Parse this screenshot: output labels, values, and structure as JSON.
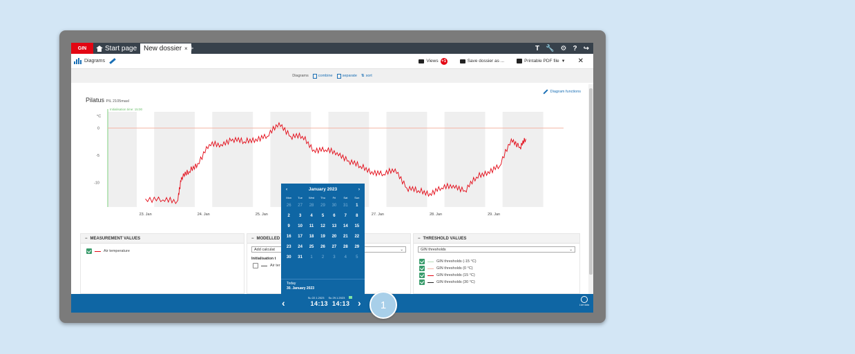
{
  "tabs": {
    "brand": "GIN",
    "home_label": "Start page",
    "active_label": "New dossier",
    "close_glyph": "×",
    "add_glyph": "+",
    "right_icons": [
      "T",
      "🔧",
      "⚙",
      "?",
      "↪"
    ]
  },
  "toolbar": {
    "title": "Diagrams",
    "views_label": "Views",
    "views_count": "+1",
    "save_label": "Save dossier as ...",
    "print_label": "Printable PDF file",
    "close_glyph": "✕"
  },
  "subbar": {
    "label": "Diagrams",
    "combine": "combine",
    "separate": "separate",
    "sort": "sort"
  },
  "chart": {
    "functions_label": "Diagram functions",
    "title": "Pilatus",
    "subtitle": "PIL 2105masl",
    "init_label": "Initialisation time: 15:00",
    "ylabel": "°C"
  },
  "chart_data": {
    "type": "line",
    "title": "Pilatus",
    "ylabel": "°C",
    "x_ticks": [
      "23. Jan",
      "24. Jan",
      "25. Jan",
      "26. Jan",
      "27. Jan",
      "28. Jan",
      "29. Jan"
    ],
    "y_ticks": [
      0,
      -5,
      -10
    ],
    "ylim": [
      -14.5,
      3
    ],
    "threshold_line": 0,
    "series": [
      {
        "name": "Air temperature",
        "color": "#e30613",
        "x": [
          0,
          0.3,
          0.55,
          0.62,
          0.75,
          0.9,
          1.1,
          1.3,
          1.5,
          1.7,
          1.9,
          2.1,
          2.3,
          2.5,
          2.7,
          2.9,
          3.1,
          3.3,
          3.5,
          3.7,
          3.9,
          4.1,
          4.3,
          4.5,
          4.7,
          4.9,
          5.1,
          5.3,
          5.5,
          5.7,
          5.9,
          6.1,
          6.3,
          6.45,
          6.55
        ],
        "values": [
          -13,
          -13.2,
          -13.4,
          -9,
          -8,
          -6.5,
          -3,
          -3,
          -2,
          -2.5,
          -2,
          -1.5,
          1,
          -1.5,
          -1.5,
          -4,
          -4,
          -4.5,
          -6,
          -7,
          -8,
          -8.5,
          -7.5,
          -11,
          -11.5,
          -12,
          -11,
          -10.5,
          -11.5,
          -9,
          -8,
          -7,
          -2,
          -3.5,
          -2
        ]
      }
    ]
  },
  "panels": {
    "measurement": {
      "title": "MEASUREMENT VALUES",
      "items": [
        {
          "label": "Air temperature",
          "checked": true,
          "color": "#e30613"
        }
      ]
    },
    "modelled": {
      "title": "MODELLED",
      "select_value": "Add calculat",
      "sub_title": "Initialisation t",
      "items": [
        {
          "label": "Air ter",
          "checked": false,
          "color": "#555555"
        }
      ]
    },
    "threshold": {
      "title": "THRESHOLD VALUES",
      "select_value": "GIN thresholds",
      "items": [
        {
          "label": "GIN thresholds (-15 °C)",
          "checked": true,
          "color": "#b7dcb7"
        },
        {
          "label": "GIN thresholds (0 °C)",
          "checked": true,
          "color": "#f3b4a4"
        },
        {
          "label": "GIN thresholds (15 °C)",
          "checked": true,
          "color": "#e30613"
        },
        {
          "label": "GIN thresholds (30 °C)",
          "checked": true,
          "color": "#222222"
        }
      ]
    }
  },
  "calendar": {
    "month": "January 2023",
    "weekdays": [
      "Mon",
      "Tue",
      "Wed",
      "Thu",
      "Fri",
      "Sat",
      "Sun"
    ],
    "days": [
      [
        "26",
        true
      ],
      [
        "27",
        true
      ],
      [
        "28",
        true
      ],
      [
        "29",
        true
      ],
      [
        "30",
        true
      ],
      [
        "31",
        true
      ],
      [
        "1",
        false
      ],
      [
        "2",
        false
      ],
      [
        "3",
        false
      ],
      [
        "4",
        false
      ],
      [
        "5",
        false
      ],
      [
        "6",
        false
      ],
      [
        "7",
        false
      ],
      [
        "8",
        false
      ],
      [
        "9",
        false
      ],
      [
        "10",
        false
      ],
      [
        "11",
        false
      ],
      [
        "12",
        false
      ],
      [
        "13",
        false
      ],
      [
        "14",
        false
      ],
      [
        "15",
        false
      ],
      [
        "16",
        false
      ],
      [
        "17",
        false
      ],
      [
        "18",
        false
      ],
      [
        "19",
        false
      ],
      [
        "20",
        false
      ],
      [
        "21",
        false
      ],
      [
        "22",
        false
      ],
      [
        "23",
        false
      ],
      [
        "24",
        false
      ],
      [
        "25",
        false
      ],
      [
        "26",
        false
      ],
      [
        "27",
        false
      ],
      [
        "28",
        false
      ],
      [
        "29",
        false
      ],
      [
        "30",
        false
      ],
      [
        "31",
        false
      ],
      [
        "1",
        true
      ],
      [
        "2",
        true
      ],
      [
        "3",
        true
      ],
      [
        "4",
        true
      ],
      [
        "5",
        true
      ]
    ],
    "today_label": "Today",
    "today_date": "30. January 2023"
  },
  "timebar": {
    "from_date": "Su 22.1.2023",
    "to_date": "Su 29.1.2023",
    "from_time": "14:13",
    "to_time": "14:13",
    "live_label": "Live data"
  },
  "step_marker": "1",
  "colors": {
    "brand_red": "#e30613",
    "accent_blue": "#0f66a4",
    "tab_bar": "#37414b",
    "check_green": "#3a9c6c"
  }
}
